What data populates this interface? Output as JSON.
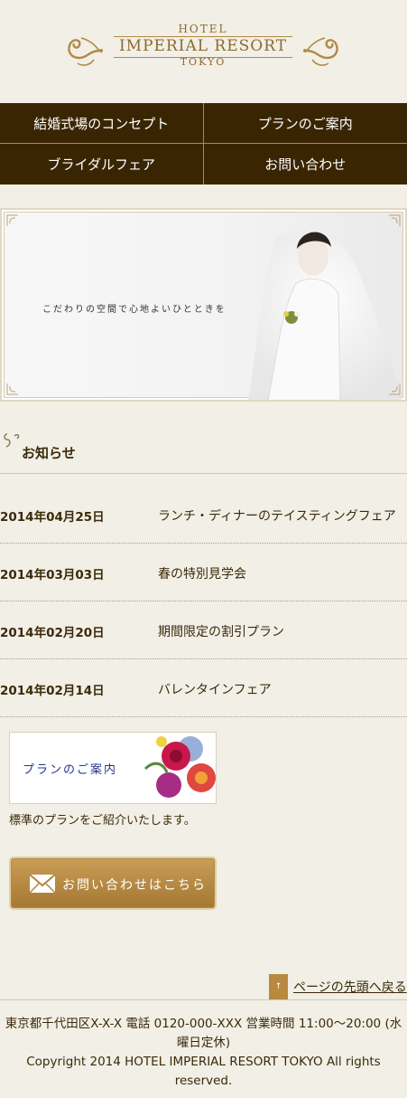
{
  "logo": {
    "line1": "HOTEL",
    "line2": "IMPERIAL RESORT",
    "line3": "TOKYO"
  },
  "nav": {
    "items": [
      {
        "label": "結婚式場のコンセプト"
      },
      {
        "label": "プランのご案内"
      },
      {
        "label": "ブライダルフェア"
      },
      {
        "label": "お問い合わせ"
      }
    ]
  },
  "hero": {
    "caption": "こだわりの空間で心地よいひとときを"
  },
  "news": {
    "title": "お知らせ",
    "items": [
      {
        "date": "2014年04月25日",
        "text": "ランチ・ディナーのテイスティングフェア"
      },
      {
        "date": "2014年03月03日",
        "text": "春の特別見学会"
      },
      {
        "date": "2014年02月20日",
        "text": "期間限定の割引プラン"
      },
      {
        "date": "2014年02月14日",
        "text": "バレンタインフェア"
      }
    ]
  },
  "plan": {
    "banner_label": "プランのご案内",
    "description": "標準のプランをご紹介いたします。"
  },
  "contact": {
    "button_label": "お問い合わせはこちら"
  },
  "to_top": {
    "label": "ページの先頭へ戻る"
  },
  "footer": {
    "address": "東京都千代田区X-X-X 電話 0120-000-XXX 営業時間 11:00〜20:00 (水曜日定休)",
    "copyright": "Copyright 2014 HOTEL IMPERIAL RESORT TOKYO All rights reserved."
  },
  "colors": {
    "nav_bg": "#3a2503",
    "gold": "#b18a45",
    "page_bg": "#f1efe6"
  }
}
